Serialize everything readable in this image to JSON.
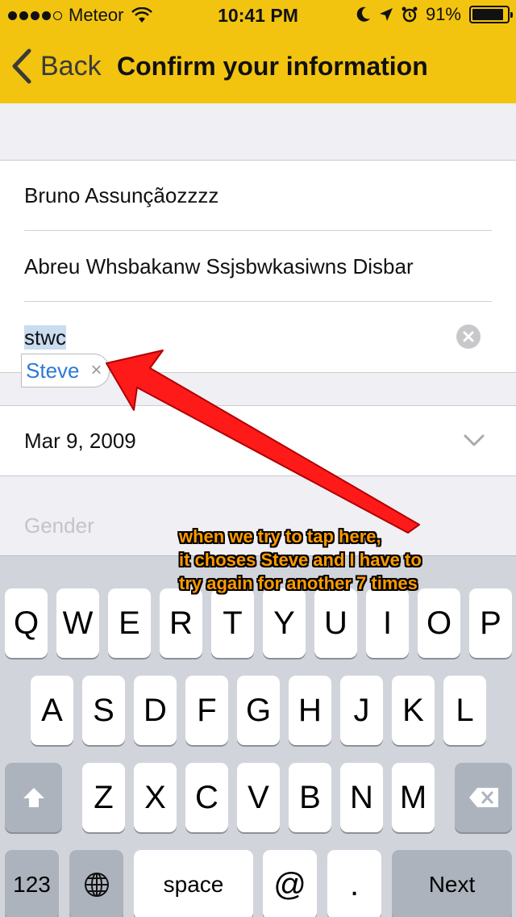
{
  "status_bar": {
    "carrier": "Meteor",
    "time": "10:41 PM",
    "battery": "91%",
    "battery_level": 0.91
  },
  "nav": {
    "back_label": "Back",
    "title": "Confirm your information"
  },
  "form": {
    "first_name": "Bruno Assunçãozzzz",
    "last_name": "Abreu Whsbakanw Ssjsbwkasiwns Disbar",
    "school_input": "stwc",
    "suggestion_chip": "Steve",
    "chip_close": "×",
    "date": "Mar 9, 2009",
    "gender_placeholder": "Gender"
  },
  "annotation": {
    "line1": "when we try to tap here,",
    "line2": "it choses Steve and I have to",
    "line3": "try again for another 7 times"
  },
  "keyboard": {
    "row1": [
      "Q",
      "W",
      "E",
      "R",
      "T",
      "Y",
      "U",
      "I",
      "O",
      "P"
    ],
    "row2": [
      "A",
      "S",
      "D",
      "F",
      "G",
      "H",
      "J",
      "K",
      "L"
    ],
    "row3": [
      "Z",
      "X",
      "C",
      "V",
      "B",
      "N",
      "M"
    ],
    "bottom": {
      "numbers": "123",
      "space": "space",
      "at": "@",
      "dot": ".",
      "next": "Next"
    }
  },
  "colors": {
    "header": "#f2c410",
    "chip_text": "#2c7ad6",
    "annotation_text": "#ff9b00",
    "arrow": "#ff1a1a"
  }
}
